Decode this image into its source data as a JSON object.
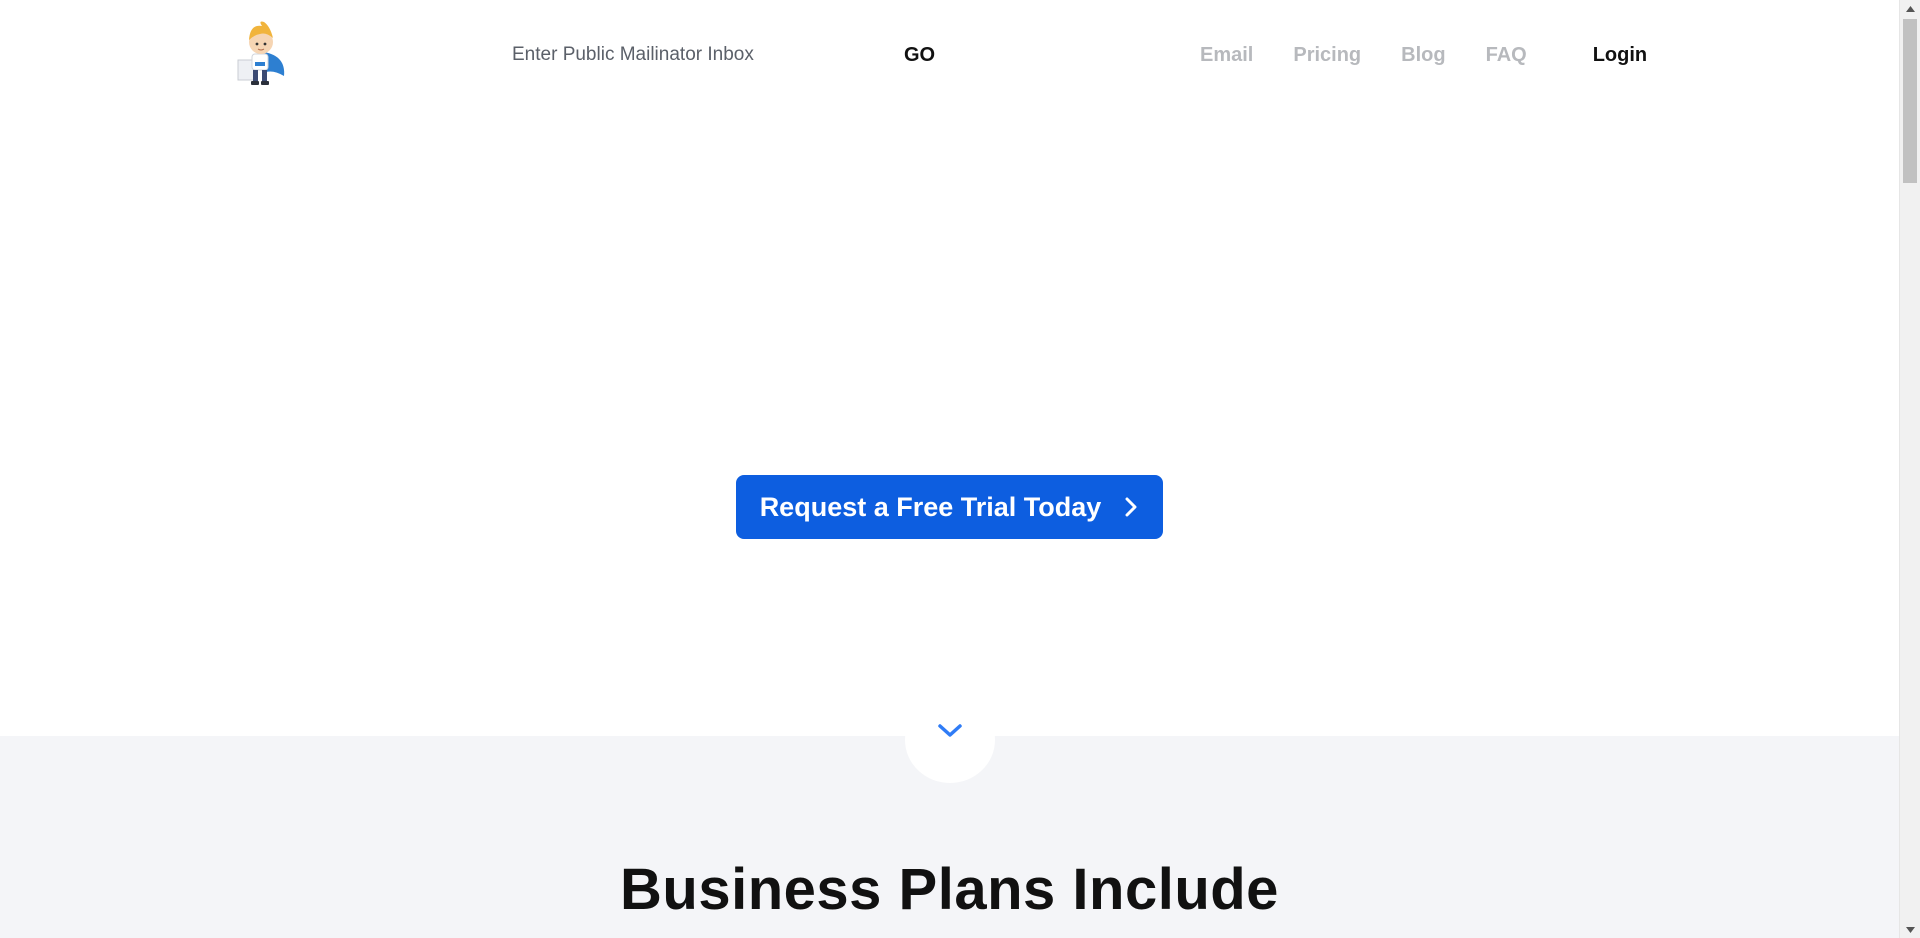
{
  "header": {
    "search": {
      "placeholder": "Enter Public Mailinator Inbox"
    },
    "go_label": "GO",
    "nav": {
      "email": "Email",
      "pricing": "Pricing",
      "blog": "Blog",
      "faq": "FAQ",
      "login": "Login"
    }
  },
  "hero": {
    "cta_label": "Request a Free Trial Today",
    "cta_icon": "chevron-right-icon"
  },
  "plans": {
    "scroll_icon": "chevron-down-icon",
    "title": "Business Plans Include"
  },
  "colors": {
    "accent": "#0d5ee0",
    "nav_muted": "#b7b9bd",
    "section_bg": "#f4f5f8",
    "chevron": "#2f7cf6"
  }
}
